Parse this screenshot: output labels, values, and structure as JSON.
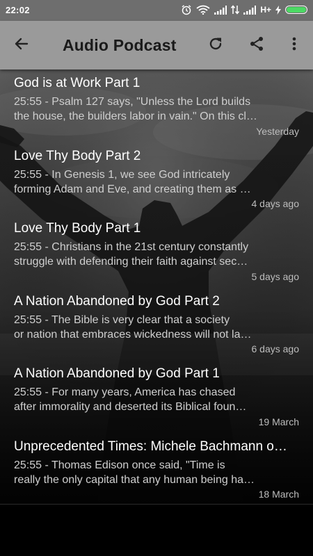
{
  "status_bar": {
    "time": "22:02",
    "network": "H+",
    "icons": [
      "alarm-icon",
      "wifi-icon",
      "signal-icon",
      "data-arrows-icon",
      "signal-icon",
      "charging-icon",
      "battery-icon"
    ],
    "battery_color": "#4cd964"
  },
  "app_bar": {
    "title": "Audio Podcast",
    "back_icon": "arrow-back-icon",
    "refresh_icon": "refresh-icon",
    "share_icon": "share-icon",
    "more_icon": "more-vertical-icon",
    "background_color": "#9a9a9a"
  },
  "episodes": [
    {
      "title": "God is at Work Part 1",
      "desc_line1": "25:55 - Psalm 127 says, \"Unless the Lord builds",
      "desc_line2": "the house, the builders labor in vain.\" On this cl…",
      "date": "Yesterday"
    },
    {
      "title": "Love Thy Body Part 2",
      "desc_line1": "25:55 - In Genesis 1, we see God intricately",
      "desc_line2": "forming Adam and Eve, and creating them as …",
      "date": "4 days ago"
    },
    {
      "title": "Love Thy Body Part 1",
      "desc_line1": "25:55 - Christians in the 21st century constantly",
      "desc_line2": "struggle with defending their faith against sec…",
      "date": "5 days ago"
    },
    {
      "title": "A Nation Abandoned by God Part 2",
      "desc_line1": "25:55 - The Bible is very clear that a society",
      "desc_line2": "or nation that embraces wickedness will not la…",
      "date": "6 days ago"
    },
    {
      "title": "A Nation Abandoned by God Part 1",
      "desc_line1": "25:55 - For many years, America has chased",
      "desc_line2": "after immorality and deserted its Biblical foun…",
      "date": "19 March"
    },
    {
      "title": "Unprecedented Times: Michele Bachmann o…",
      "desc_line1": "25:55 - Thomas Edison once said, \"Time is",
      "desc_line2": "really the only capital that any human being ha…",
      "date": "18 March"
    }
  ]
}
